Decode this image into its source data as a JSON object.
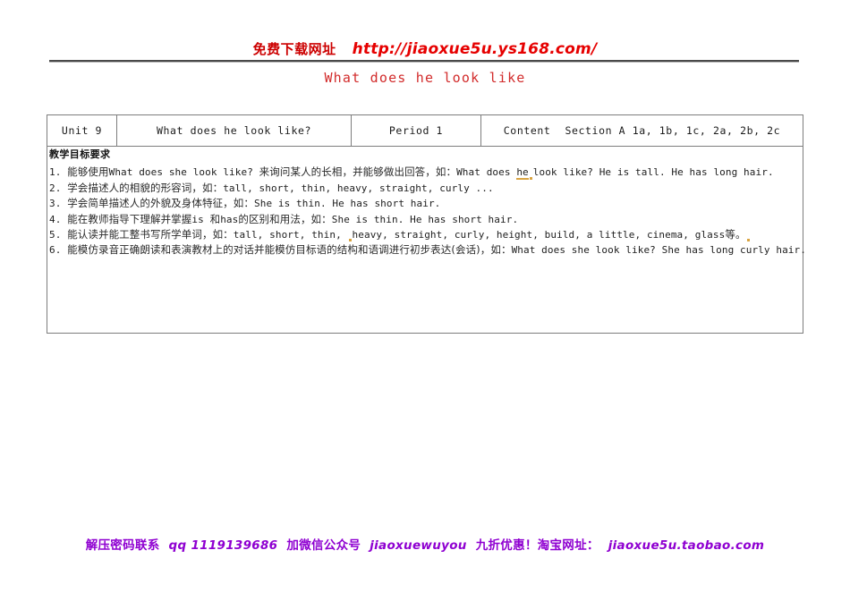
{
  "banner": {
    "cn_label": "免费下载网址",
    "url": "http://jiaoxue5u.ys168.com/",
    "cn_color": "#cc0000",
    "url_color": "#e60000"
  },
  "document": {
    "title": "What does he look like",
    "title_color": "#d22b2b"
  },
  "table": {
    "header": {
      "unit": "Unit 9",
      "lesson_title": "What does he look like?",
      "period": "Period 1",
      "content_label": "Content",
      "content_value": "Section A  1a, 1b, 1c, 2a, 2b, 2c"
    },
    "body": {
      "heading": "教学目标要求",
      "objectives": [
        {
          "number": "1.",
          "pre": "能够使用",
          "en1": "What does she look like?",
          "mid": "来询问某人的长相，并能够做出回答，如：",
          "en2_a": "What does ",
          "en2_marked": "he",
          "en2_b": "look like? He is tall. He has long hair."
        },
        {
          "number": "2.",
          "pre": "学会描述人的相貌的形容词，如：",
          "en1": "tall, short, thin, heavy, straight, curly ..."
        },
        {
          "number": "3.",
          "pre": "学会简单描述人的外貌及身体特征，如：",
          "en1": "She is thin. He has short hair."
        },
        {
          "number": "4.",
          "pre": "能在教师指导下理解并掌握",
          "en1": "is",
          "mid": "和",
          "en2_a": "has",
          "mid2": "的区别和用法，如：",
          "en2_b": "She is thin. He has short hair."
        },
        {
          "number": "5.",
          "pre": "能认读并能工整书写所学单词，如：",
          "en1": "tall, short, thin, ",
          "en1_marked": "heavy",
          "en1_b": ", straight, curly, height, build, a little, cinema, glass",
          "tail": "等。"
        },
        {
          "number": "6.",
          "pre": "能模仿录音正确朗读和表演教材上的对话并能模仿目标语的结构和语调进行初步表达(会话)，如：",
          "en1": "What does she look like? She has long curly hair."
        }
      ]
    }
  },
  "footer": {
    "segment1": "解压密码联系",
    "segment2": "qq 1119139686",
    "segment3": "加微信公众号",
    "segment4": "jiaoxuewuyou",
    "segment5": "九折优惠！淘宝网址：",
    "segment6": "jiaoxue5u.taobao.com",
    "color": "#8f00d1"
  }
}
